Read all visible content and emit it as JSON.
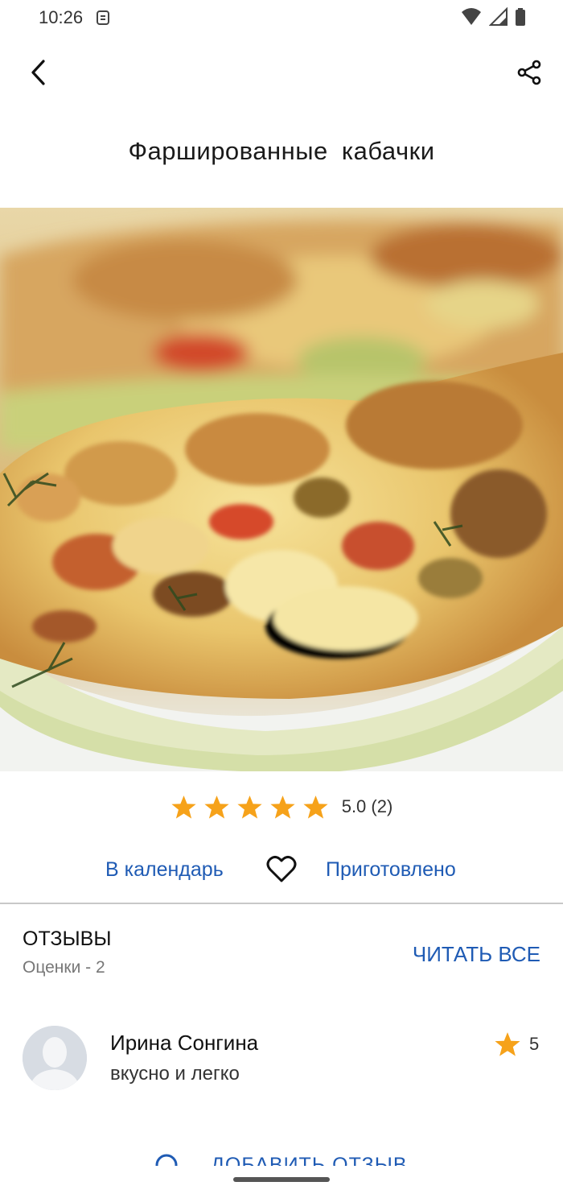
{
  "status_bar": {
    "time": "10:26"
  },
  "recipe": {
    "title": "Фаршированные  кабачки",
    "rating_text": "5.0 (2)",
    "stars": 5
  },
  "actions": {
    "calendar_label": "В календарь",
    "cooked_label": "Приготовлено"
  },
  "reviews": {
    "title": "ОТЗЫВЫ",
    "subtitle": "Оценки - 2",
    "read_all_label": "ЧИТАТЬ ВСЕ",
    "items": [
      {
        "name": "Ирина Сонгина",
        "text": "вкусно и легко",
        "score": "5"
      }
    ],
    "add_review_label": "ДОБАВИТЬ ОТЗЫВ"
  },
  "colors": {
    "accent": "#1f5bb4",
    "star": "#f6a21a"
  }
}
